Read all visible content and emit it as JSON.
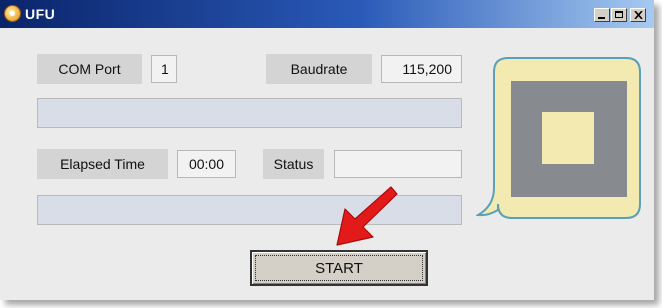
{
  "window": {
    "title": "UFU",
    "controls": {
      "minimize_icon": "minimize-icon",
      "maximize_icon": "maximize-icon",
      "close_icon": "close-icon"
    }
  },
  "form": {
    "com_port_label": "COM Port",
    "com_port_value": "1",
    "baudrate_label": "Baudrate",
    "baudrate_value": "115,200",
    "elapsed_time_label": "Elapsed Time",
    "elapsed_time_value": "00:00",
    "status_label": "Status",
    "status_value": ""
  },
  "start_button": {
    "label": "START"
  },
  "callout": {
    "icon": "device-status-icon",
    "border_color": "#5aa0b8",
    "fill_color": "#f2eab0",
    "square_color": "#878a8e"
  },
  "annotation_arrow": {
    "icon": "red-arrow-icon",
    "color": "#e21a1a"
  }
}
